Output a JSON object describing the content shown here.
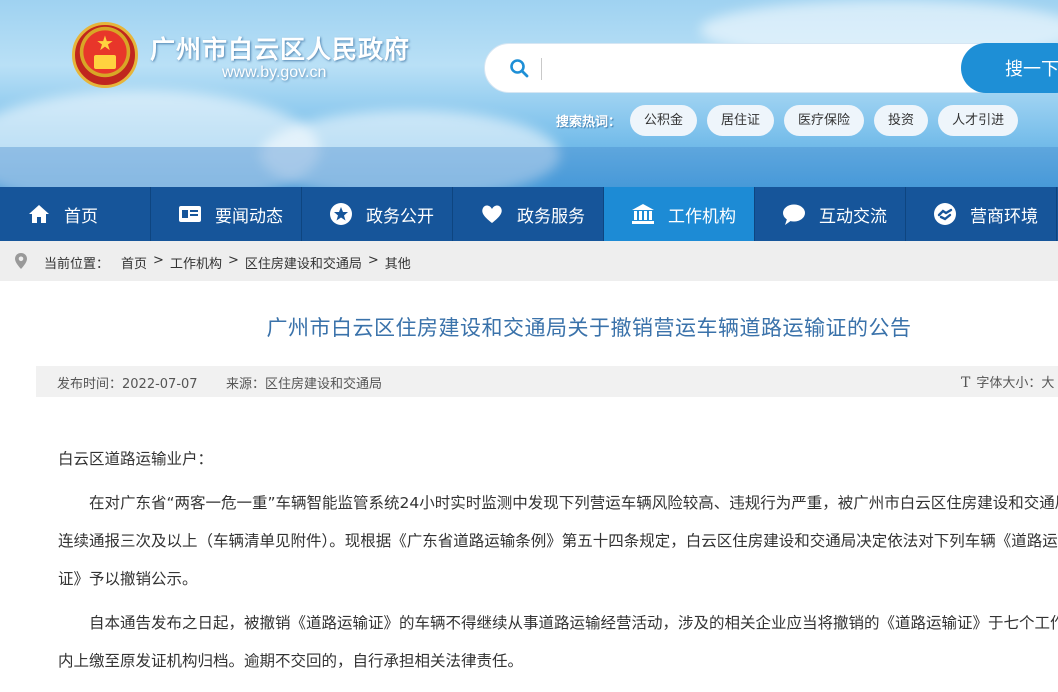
{
  "header": {
    "site_title": "广州市白云区人民政府",
    "site_url": "www.by.gov.cn",
    "search": {
      "placeholder": "",
      "button_label": "搜一下"
    },
    "hot_label": "搜索热词：",
    "hot_tags": [
      "公积金",
      "居住证",
      "医疗保险",
      "投资",
      "人才引进"
    ]
  },
  "nav": {
    "items": [
      {
        "label": "首页",
        "icon": "home-icon"
      },
      {
        "label": "要闻动态",
        "icon": "news-card-icon"
      },
      {
        "label": "政务公开",
        "icon": "star-circle-icon"
      },
      {
        "label": "政务服务",
        "icon": "heart-icon"
      },
      {
        "label": "工作机构",
        "icon": "building-icon",
        "active": true
      },
      {
        "label": "互动交流",
        "icon": "chat-bubble-icon"
      },
      {
        "label": "营商环境",
        "icon": "handshake-icon"
      }
    ]
  },
  "breadcrumb": {
    "prefix": "当前位置：",
    "items": [
      "首页",
      "工作机构",
      "区住房建设和交通局",
      "其他"
    ],
    "separator": ">"
  },
  "article": {
    "title": "广州市白云区住房建设和交通局关于撤销营运车辆道路运输证的公告",
    "date_text": "发布时间：2022-07-07",
    "source_text": "来源：区住房建设和交通局",
    "font_size_label": "字体大小：",
    "font_size_option": "大",
    "greeting": "白云区道路运输业户：",
    "paragraphs": [
      "在对广东省“两客一危一重”车辆智能监管系统24小时实时监测中发现下列营运车辆风险较高、违规行为严重，被广州市白云区住房建设和交通局",
      "连续通报三次及以上（车辆清单见附件）。现根据《广东省道路运输条例》第五十四条规定，白云区住房建设和交通局决定依法对下列车辆《道路运输",
      "证》予以撤销公示。",
      "自本通告发布之日起，被撤销《道路运输证》的车辆不得继续从事道路运输经营活动，涉及的相关企业应当将撤销的《道路运输证》于七个工作日",
      "内上缴至原发证机构归档。逾期不交回的，自行承担相关法律责任。"
    ]
  },
  "colors": {
    "nav_bg": "#16559a",
    "nav_active": "#1d8bd5",
    "title_blue": "#3a72aa",
    "search_button": "#1e8fd6"
  }
}
